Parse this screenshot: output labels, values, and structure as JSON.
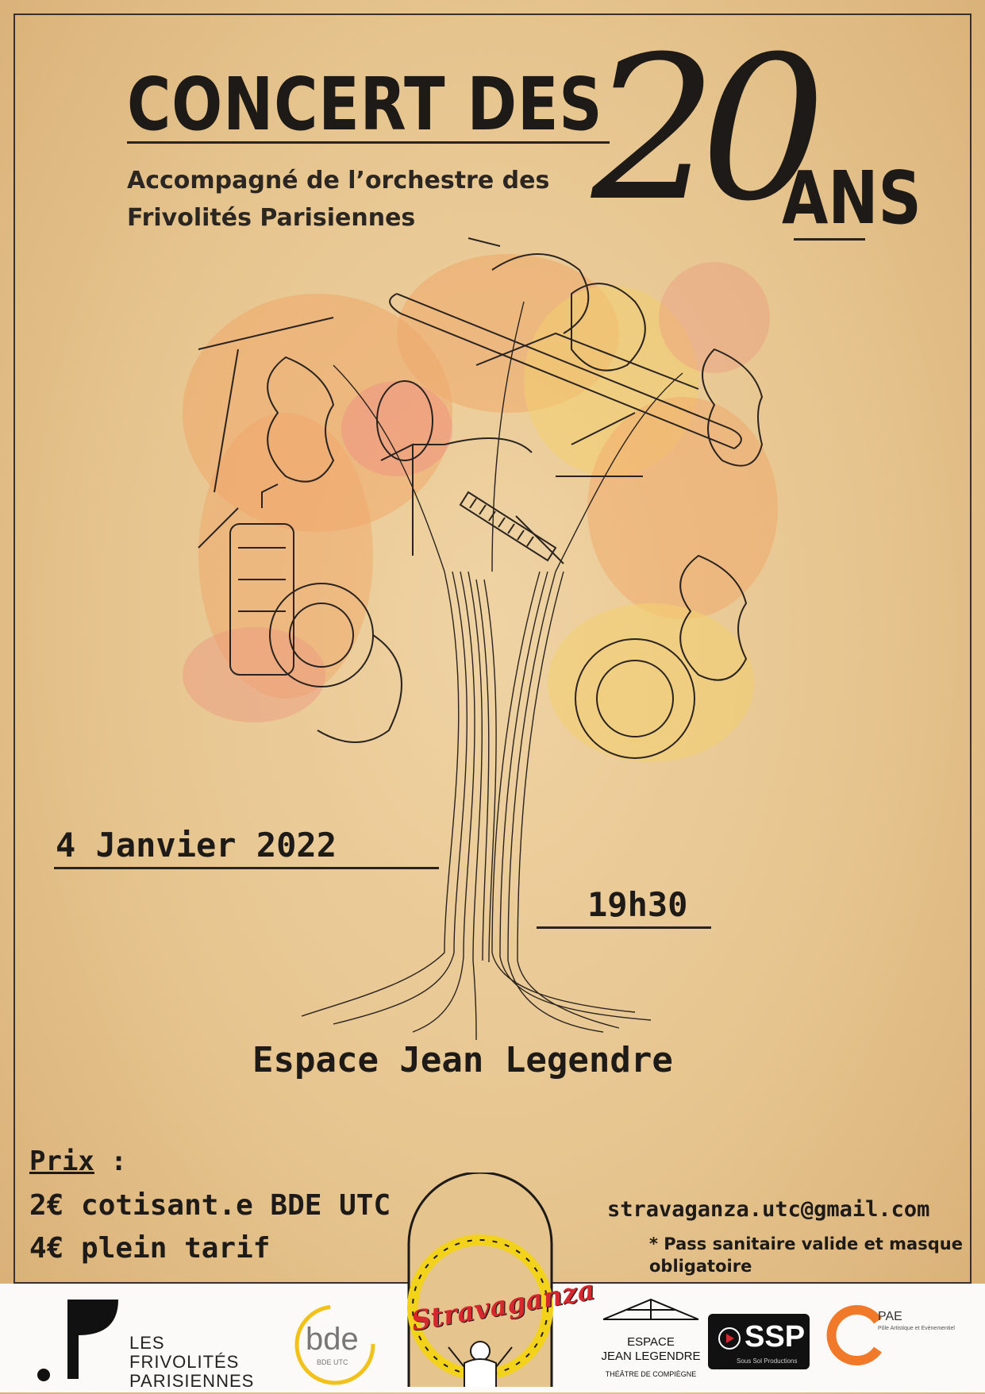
{
  "title": {
    "main": "CONCERT DES",
    "number": "20",
    "suffix": "ANS"
  },
  "subtitle": {
    "line1": "Accompagné de l’orchestre des",
    "line2": "Frivolités Parisiennes"
  },
  "event": {
    "date": "4 Janvier 2022",
    "time": "19h30",
    "venue": "Espace Jean Legendre"
  },
  "pricing": {
    "heading": "Prix",
    "heading_suffix": " :",
    "items": [
      "2€ cotisant.e BDE UTC",
      "4€ plein tarif"
    ]
  },
  "contact": {
    "email": "stravaganza.utc@gmail.com"
  },
  "note": {
    "marker": "*",
    "text": "Pass sanitaire valide et masque obligatoire"
  },
  "logos": {
    "frivolites": {
      "line1": "LES",
      "line2": "FRIVOLITÉS",
      "line3": "PARISIENNES",
      "mark": ".F"
    },
    "bde": {
      "text": "bde",
      "sub": "BDE UTC"
    },
    "stravaganza": {
      "text": "Stravaganza"
    },
    "espace": {
      "line1": "ESPACE",
      "line2": "JEAN LEGENDRE",
      "line3": "THÉÂTRE DE COMPIÈGNE"
    },
    "ssp": {
      "text": "SSP",
      "sub": "Sous Sol Productions"
    },
    "pae": {
      "text": "PAE",
      "sub": "Pôle Artistique et Evènementiel"
    }
  },
  "colors": {
    "paper": "#e6c48e",
    "ink": "#1e1a17",
    "blob_orange": "#f1a262",
    "blob_pink": "#ee8f7d",
    "blob_yellow": "#f3cf6a",
    "strava_red": "#d8262e",
    "pae_orange": "#f07a2a",
    "bde_yellow": "#f2c21b"
  }
}
